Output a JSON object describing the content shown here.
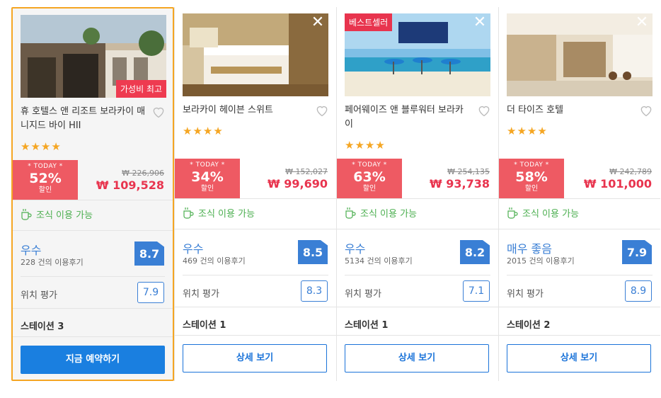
{
  "cards": [
    {
      "name": "휴 호텔스 앤 리조트 보라카이 매니지드 바이 HII",
      "value_badge": "가성비 최고",
      "stars": 4,
      "deal_today": "* TODAY *",
      "deal_pct": "52%",
      "deal_off": "할인",
      "original_price": "₩ 226,906",
      "price": "₩ 109,528",
      "breakfast": "조식 이용 가능",
      "rating_label": "우수",
      "reviews": "228 건의 이용후기",
      "score": "8.7",
      "location_label": "위치 평가",
      "location_score": "7.9",
      "station": "스테이션 3",
      "button": "지금 예약하기",
      "selected": true
    },
    {
      "name": "보라카이 헤이븐 스위트",
      "stars": 4,
      "deal_today": "* TODAY *",
      "deal_pct": "34%",
      "deal_off": "할인",
      "original_price": "₩ 152,027",
      "price": "₩ 99,690",
      "breakfast": "조식 이용 가능",
      "rating_label": "우수",
      "reviews": "469 건의 이용후기",
      "score": "8.5",
      "location_label": "위치 평가",
      "location_score": "8.3",
      "station": "스테이션 1",
      "button": "상세 보기",
      "close": "✕"
    },
    {
      "name": "페어웨이즈 앤 블루워터 보라카이",
      "best_badge": "베스트셀러",
      "stars": 4,
      "deal_today": "* TODAY *",
      "deal_pct": "63%",
      "deal_off": "할인",
      "original_price": "₩ 254,135",
      "price": "₩ 93,738",
      "breakfast": "조식 이용 가능",
      "rating_label": "우수",
      "reviews": "5134 건의 이용후기",
      "score": "8.2",
      "location_label": "위치 평가",
      "location_score": "7.1",
      "station": "스테이션 1",
      "button": "상세 보기",
      "close": "✕"
    },
    {
      "name": "더 타이즈 호텔",
      "stars": 4,
      "deal_today": "* TODAY *",
      "deal_pct": "58%",
      "deal_off": "할인",
      "original_price": "₩ 242,789",
      "price": "₩ 101,000",
      "breakfast": "조식 이용 가능",
      "rating_label": "매우 좋음",
      "reviews": "2015 건의 이용후기",
      "score": "7.9",
      "location_label": "위치 평가",
      "location_score": "8.9",
      "station": "스테이션 2",
      "button": "상세 보기",
      "close": "✕"
    }
  ],
  "colors": {
    "accent_blue": "#1a73d9",
    "price_red": "#e8344e",
    "deal_bg": "#ee5a63",
    "star": "#f5a623",
    "breakfast_green": "#4caf50",
    "selected_border": "#f5a623"
  }
}
